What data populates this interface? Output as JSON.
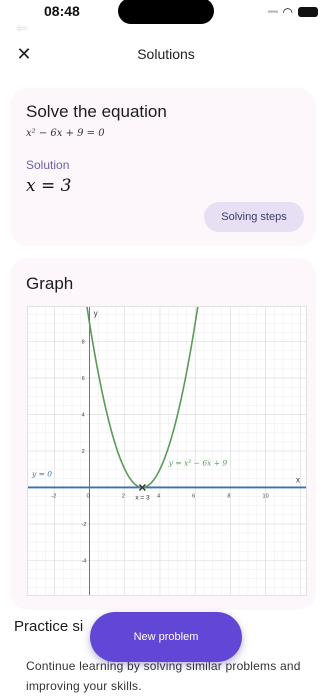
{
  "status_bar": {
    "time": "08:48"
  },
  "header": {
    "title": "Solutions"
  },
  "solve_card": {
    "title": "Solve the equation",
    "equation": "x² − 6x + 9 = 0",
    "solution_label": "Solution",
    "solution_value": "x = 3",
    "steps_button": "Solving steps"
  },
  "graph_card": {
    "title": "Graph",
    "y_axis_label": "y",
    "x_axis_label": "x",
    "curve_label": "y = x² − 6x + 9",
    "line_label": "y = 0",
    "root_label": "x = 3",
    "x_ticks": [
      "-2",
      "0",
      "2",
      "4",
      "6",
      "8",
      "10"
    ],
    "y_ticks": [
      "8",
      "6",
      "4",
      "2",
      "-2",
      "-4"
    ]
  },
  "chart_data": {
    "type": "line",
    "series": [
      {
        "name": "y = x² − 6x + 9",
        "x": [
          -2,
          -1,
          0,
          1,
          2,
          3,
          4,
          5,
          6,
          7,
          8
        ],
        "y": [
          25,
          16,
          9,
          4,
          1,
          0,
          1,
          4,
          9,
          16,
          25
        ]
      },
      {
        "name": "y = 0",
        "x": [
          -3,
          12
        ],
        "y": [
          0,
          0
        ]
      }
    ],
    "xlim": [
      -3.5,
      12.3
    ],
    "ylim": [
      -5.9,
      9.9
    ],
    "grid": true,
    "colors": {
      "curve": "#5a9a5a",
      "line": "#3a6fb8"
    }
  },
  "practice": {
    "title": "Practice si",
    "text": "Continue learning by solving similar problems and improving your skills."
  },
  "fab": {
    "label": "New problem"
  }
}
